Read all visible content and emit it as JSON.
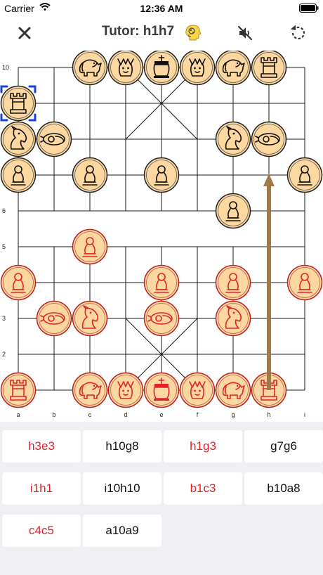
{
  "status": {
    "carrier": "Carrier",
    "time": "12:36 AM"
  },
  "nav": {
    "title": "Tutor: h1h7",
    "close_icon": "close-icon",
    "hint_icon": "tutor-head-icon",
    "sound_icon": "speaker-muted-icon",
    "undo_icon": "rotate-ccw-icon"
  },
  "board": {
    "files": [
      "a",
      "b",
      "c",
      "d",
      "e",
      "f",
      "g",
      "h",
      "i"
    ],
    "rank_labels": [
      "10",
      "",
      "",
      "",
      "6",
      "5",
      "",
      "3",
      "2",
      ""
    ],
    "selected": "a9",
    "arrow": {
      "from": "h1",
      "to": "h7",
      "color": "#a0784a"
    },
    "pieces": [
      {
        "side": "black",
        "type": "horse",
        "file": "c",
        "rank": 10
      },
      {
        "side": "black",
        "type": "advisor",
        "file": "d",
        "rank": 10
      },
      {
        "side": "black",
        "type": "king",
        "file": "e",
        "rank": 10
      },
      {
        "side": "black",
        "type": "advisor",
        "file": "f",
        "rank": 10
      },
      {
        "side": "black",
        "type": "horse",
        "file": "g",
        "rank": 10
      },
      {
        "side": "black",
        "type": "rook",
        "file": "h",
        "rank": 10
      },
      {
        "side": "black",
        "type": "rook",
        "file": "a",
        "rank": 9
      },
      {
        "side": "black",
        "type": "knight",
        "file": "a",
        "rank": 8
      },
      {
        "side": "black",
        "type": "cannon",
        "file": "b",
        "rank": 8
      },
      {
        "side": "black",
        "type": "knight",
        "file": "g",
        "rank": 8
      },
      {
        "side": "black",
        "type": "cannon",
        "file": "h",
        "rank": 8
      },
      {
        "side": "black",
        "type": "pawn",
        "file": "a",
        "rank": 7
      },
      {
        "side": "black",
        "type": "pawn",
        "file": "c",
        "rank": 7
      },
      {
        "side": "black",
        "type": "pawn",
        "file": "e",
        "rank": 7
      },
      {
        "side": "black",
        "type": "pawn",
        "file": "i",
        "rank": 7
      },
      {
        "side": "black",
        "type": "pawn",
        "file": "g",
        "rank": 6
      },
      {
        "side": "red",
        "type": "pawn",
        "file": "c",
        "rank": 5
      },
      {
        "side": "red",
        "type": "pawn",
        "file": "a",
        "rank": 4
      },
      {
        "side": "red",
        "type": "pawn",
        "file": "e",
        "rank": 4
      },
      {
        "side": "red",
        "type": "pawn",
        "file": "g",
        "rank": 4
      },
      {
        "side": "red",
        "type": "pawn",
        "file": "i",
        "rank": 4
      },
      {
        "side": "red",
        "type": "cannon",
        "file": "b",
        "rank": 3
      },
      {
        "side": "red",
        "type": "knight",
        "file": "c",
        "rank": 3
      },
      {
        "side": "red",
        "type": "cannon",
        "file": "e",
        "rank": 3
      },
      {
        "side": "red",
        "type": "knight",
        "file": "g",
        "rank": 3
      },
      {
        "side": "red",
        "type": "rook",
        "file": "a",
        "rank": 1
      },
      {
        "side": "red",
        "type": "horse",
        "file": "c",
        "rank": 1
      },
      {
        "side": "red",
        "type": "advisor",
        "file": "d",
        "rank": 1
      },
      {
        "side": "red",
        "type": "king",
        "file": "e",
        "rank": 1
      },
      {
        "side": "red",
        "type": "advisor",
        "file": "f",
        "rank": 1
      },
      {
        "side": "red",
        "type": "horse",
        "file": "g",
        "rank": 1
      },
      {
        "side": "red",
        "type": "rook",
        "file": "h",
        "rank": 1
      }
    ]
  },
  "moves": [
    {
      "label": "h3e3",
      "side": "red"
    },
    {
      "label": "h10g8",
      "side": "black"
    },
    {
      "label": "h1g3",
      "side": "red"
    },
    {
      "label": "g7g6",
      "side": "black"
    },
    {
      "label": "i1h1",
      "side": "red"
    },
    {
      "label": "i10h10",
      "side": "black"
    },
    {
      "label": "b1c3",
      "side": "red"
    },
    {
      "label": "b10a8",
      "side": "black"
    },
    {
      "label": "c4c5",
      "side": "red"
    },
    {
      "label": "a10a9",
      "side": "black"
    }
  ],
  "colors": {
    "red": "#e0242a",
    "black": "#111111",
    "piece_fill": "#fcd7a0",
    "selection": "#1a3fd8"
  }
}
